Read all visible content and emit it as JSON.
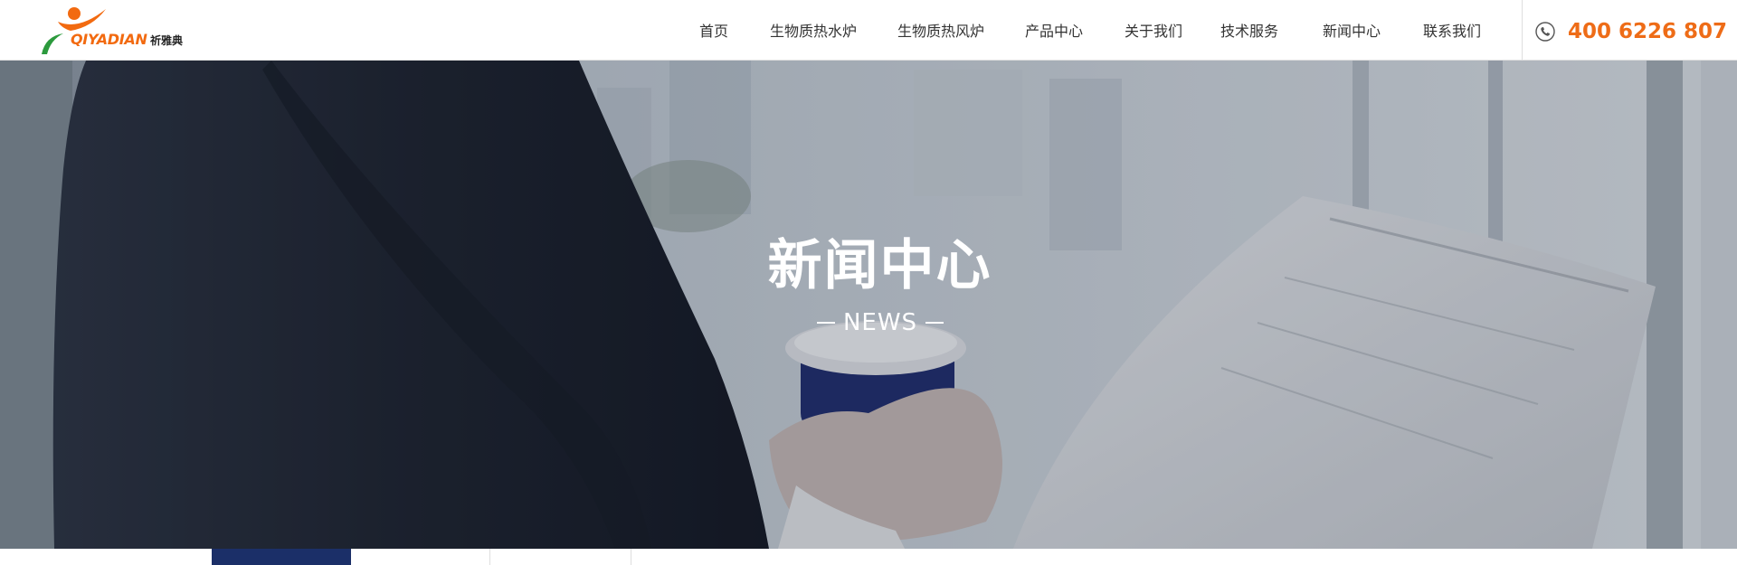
{
  "header": {
    "logo": {
      "wordmark": "QIYADIAN",
      "chinese": "祈雅典",
      "colors": {
        "orange": "#f26a10",
        "green": "#2c9a3d"
      }
    },
    "nav": {
      "items": [
        {
          "label": "首页"
        },
        {
          "label": "生物质热水炉"
        },
        {
          "label": "生物质热风炉"
        },
        {
          "label": "产品中心"
        },
        {
          "label": "关于我们"
        },
        {
          "label": "技术服务"
        },
        {
          "label": "新闻中心"
        },
        {
          "label": "联系我们"
        }
      ]
    },
    "phone": {
      "icon": "phone-icon",
      "number": "400 6226 807",
      "color": "#ee6c17"
    }
  },
  "banner": {
    "title": "新闻中心",
    "subtitle": "NEWS"
  },
  "tabs": {
    "items": [
      {
        "label": "",
        "active": true
      },
      {
        "label": ""
      },
      {
        "label": ""
      }
    ],
    "active_color": "#1b2f68"
  }
}
